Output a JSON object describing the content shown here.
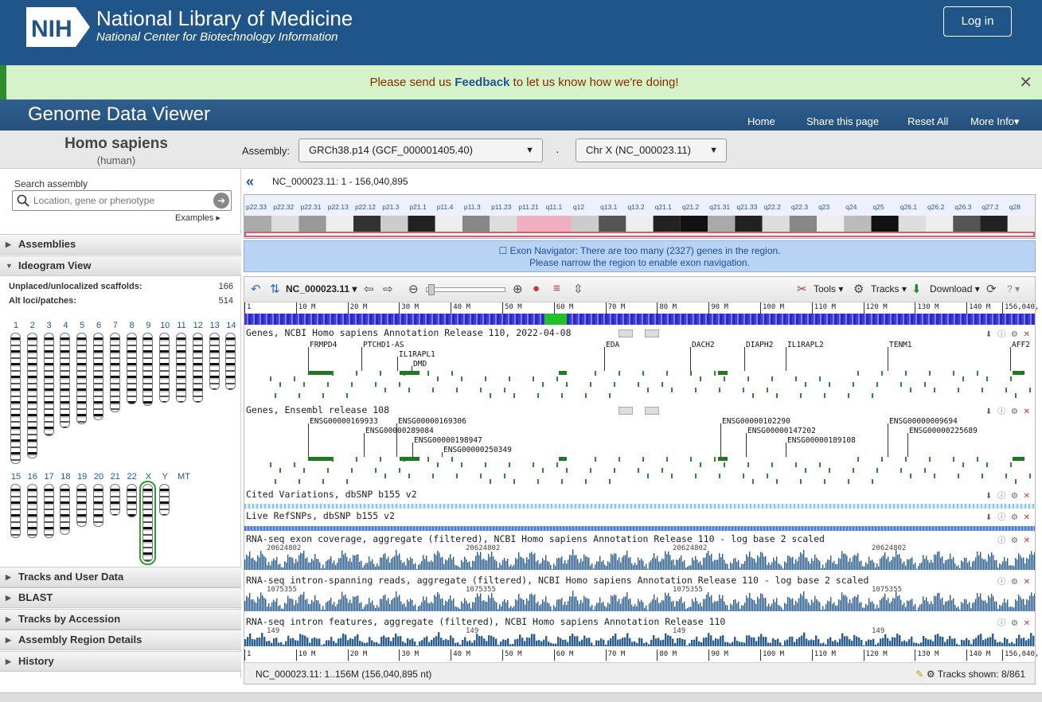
{
  "header": {
    "org_logo_text": "NIH",
    "org_name": "National Library of Medicine",
    "org_sub": "National Center for Biotechnology Information",
    "login_label": "Log in"
  },
  "feedback": {
    "before": "Please send us ",
    "link": "Feedback",
    "after": " to let us know how we're doing!",
    "close": "✕"
  },
  "app": {
    "title": "Genome Data Viewer",
    "nav": [
      "Home",
      "Share this page",
      "Reset All",
      "More Info▾"
    ]
  },
  "organism": {
    "name": "Homo sapiens",
    "common": "(human)",
    "assembly_label": "Assembly:",
    "assembly_value": "GRCh38.p14 (GCF_000001405.40)",
    "dot": "·",
    "chromosome_value": "Chr X (NC_000023.11)"
  },
  "left": {
    "search_label": "Search assembly",
    "search_placeholder": "Location, gene or phenotype",
    "examples": "Examples ▸",
    "sections_top": [
      {
        "label": "Assemblies",
        "state": "▶"
      },
      {
        "label": "Ideogram View",
        "state": "▼"
      }
    ],
    "scaffolds_label": "Unplaced/unlocalized scaffolds:",
    "scaffolds_value": "166",
    "altloci_label": "Alt loci/patches:",
    "altloci_value": "514",
    "chr_row1": [
      "1",
      "2",
      "3",
      "4",
      "5",
      "6",
      "7",
      "8",
      "9",
      "10",
      "11",
      "12",
      "13",
      "14"
    ],
    "chr_row2": [
      "15",
      "16",
      "17",
      "18",
      "19",
      "20",
      "21",
      "22",
      "X",
      "Y",
      "MT"
    ],
    "sections_bottom": [
      {
        "label": "Tracks and User Data",
        "state": "▶"
      },
      {
        "label": "BLAST",
        "state": "▶"
      },
      {
        "label": "Tracks by Accession",
        "state": "▶"
      },
      {
        "label": "Assembly Region Details",
        "state": "▶"
      },
      {
        "label": "History",
        "state": "▶"
      }
    ]
  },
  "main": {
    "back_icon": "«",
    "location": "NC_000023.11:  1 - 156,040,895",
    "bands": [
      "p22.33",
      "p22.32",
      "p22.31",
      "p22.13",
      "p22.12",
      "p21.3",
      "p21.1",
      "p11.4",
      "p11.3",
      "p11.23",
      "p11.21",
      "q11.1",
      "q12",
      "q13.1",
      "q13.2",
      "q21.1",
      "q21.2",
      "q21.31",
      "q21.33",
      "q22.2",
      "q22.3",
      "q23",
      "q24",
      "q25",
      "q26.1",
      "q26.2",
      "q26.3",
      "q27.2",
      "q28"
    ],
    "exon_nav_line1": "☐ Exon Navigator: There are too many (2327) genes in the region.",
    "exon_nav_line2": "Please narrow the region to enable exon navigation.",
    "toolbar": {
      "seq_id": "NC_000023.11 ▾",
      "tools": "Tools ▾",
      "tracks": "Tracks ▾",
      "download": "Download ▾",
      "help": "? ▾"
    },
    "ruler_labels": [
      "1",
      "10 M",
      "20 M",
      "30 M",
      "40 M",
      "50 M",
      "60 M",
      "70 M",
      "80 M",
      "90 M",
      "100 M",
      "110 M",
      "120 M",
      "130 M",
      "140 M",
      "156,040,"
    ],
    "tracks": [
      {
        "title": "Genes, NCBI Homo sapiens Annotation Release 110, 2022-04-08"
      },
      {
        "title": "Genes, Ensembl release 108"
      },
      {
        "title": "Cited Variations, dbSNP b155 v2"
      },
      {
        "title": "Live RefSNPs, dbSNP b155 v2"
      },
      {
        "title": "RNA-seq exon coverage, aggregate (filtered), NCBI Homo sapiens Annotation Release 110 - log base 2 scaled"
      },
      {
        "title": "RNA-seq intron-spanning reads, aggregate (filtered), NCBI Homo sapiens Annotation Release 110 - log base 2 scaled"
      },
      {
        "title": "RNA-seq intron features, aggregate (filtered), NCBI Homo sapiens Annotation Release 110"
      }
    ],
    "ncbi_genes": [
      "FRMPD4",
      "PTCHD1-AS",
      "IL1RAPL1",
      "DMD",
      "EDA",
      "DACH2",
      "DIAPH2",
      "IL1RAPL2",
      "TENM1",
      "AFF2"
    ],
    "ensembl_genes": [
      "ENSG00000169933",
      "ENSG00000169306",
      "ENSG00000289084",
      "ENSG00000198947",
      "ENSG00000250349",
      "ENSG00000102290",
      "ENSG00000147202",
      "ENSG00000189108",
      "ENSG00000009694",
      "ENSG00000225689"
    ],
    "rna_exon_val": "20624802",
    "rna_intron_val": "1075355",
    "rna_feat_val": "149",
    "status": "NC_000023.11: 1..156M (156,040,895 nt)",
    "tracks_shown": "Tracks shown: 8/861"
  }
}
